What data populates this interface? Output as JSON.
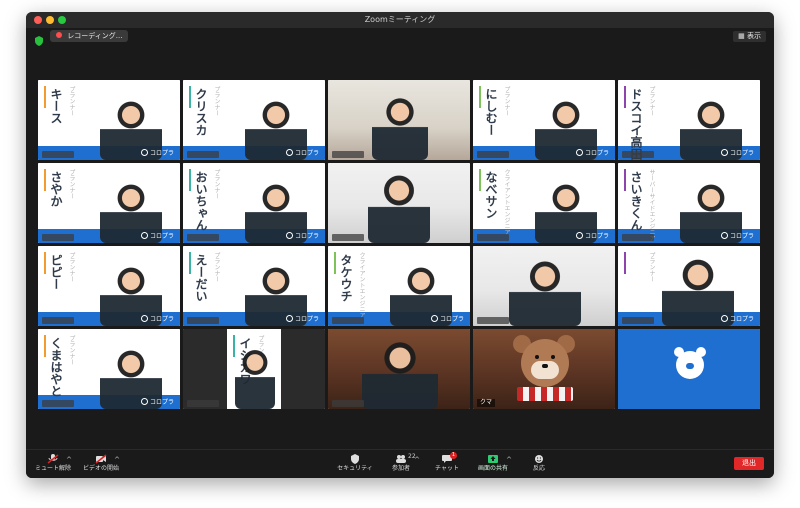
{
  "window": {
    "title": "Zoomミーティング"
  },
  "top": {
    "recording_label": "レコーディング...",
    "view_label": "表示"
  },
  "tiles": [
    {
      "name": "キース",
      "role": "プランナー",
      "stripe": "#f29b2f",
      "brand": "コロプラ"
    },
    {
      "name": "クリスカ",
      "role": "プランナー",
      "stripe": "#39b3a5",
      "brand": "コロプラ"
    },
    {
      "name": "",
      "role": "",
      "brand": ""
    },
    {
      "name": "にしむー",
      "role": "プランナー",
      "stripe": "#7dc35a",
      "brand": "コロプラ"
    },
    {
      "name": "ドスコイ高田",
      "role": "プランナー",
      "stripe": "#8e44ad",
      "brand": "コロプラ"
    },
    {
      "name": "さやか",
      "role": "プランナー",
      "stripe": "#f29b2f",
      "brand": "コロプラ"
    },
    {
      "name": "おいちゃん",
      "role": "プランナー",
      "stripe": "#39b3a5",
      "brand": "コロプラ"
    },
    {
      "name": "",
      "role": "",
      "brand": ""
    },
    {
      "name": "なべサン",
      "role": "クライアントエンジニア",
      "stripe": "#7dc35a",
      "brand": "コロプラ"
    },
    {
      "name": "さいきくん",
      "role": "サーバーサイドエンジニア",
      "stripe": "#8e44ad",
      "brand": "コロプラ"
    },
    {
      "name": "ピピー",
      "role": "プランナー",
      "stripe": "#f29b2f",
      "brand": "コロプラ"
    },
    {
      "name": "えーだい",
      "role": "プランナー",
      "stripe": "#39b3a5",
      "brand": "コロプラ"
    },
    {
      "name": "タケウチ",
      "role": "クライアントエンジニア",
      "stripe": "#7dc35a",
      "brand": "コロプラ"
    },
    {
      "name": "",
      "role": "",
      "brand": ""
    },
    {
      "name": "",
      "role": "プランナー",
      "stripe": "#8e44ad",
      "brand": "コロプラ"
    },
    {
      "name": "くまはやと",
      "role": "プランナー",
      "stripe": "#f29b2f",
      "brand": "コロプラ"
    },
    {
      "name": "イシカワ",
      "role": "プランナー",
      "stripe": "#39b3a5",
      "brand": "コロプラ"
    },
    {
      "name": "",
      "role": "",
      "brand": ""
    },
    {
      "name": "",
      "role": "",
      "brand": "",
      "label": "クマ"
    },
    {
      "name": "",
      "role": "",
      "brand": ""
    }
  ],
  "controls": {
    "mute_label": "ミュート解除",
    "video_label": "ビデオの開始",
    "security_label": "セキュリティ",
    "participants_label": "参加者",
    "participants_count": "22",
    "chat_label": "チャット",
    "chat_badge": "1",
    "share_label": "画面の共有",
    "reactions_label": "反応",
    "leave_label": "退出"
  }
}
